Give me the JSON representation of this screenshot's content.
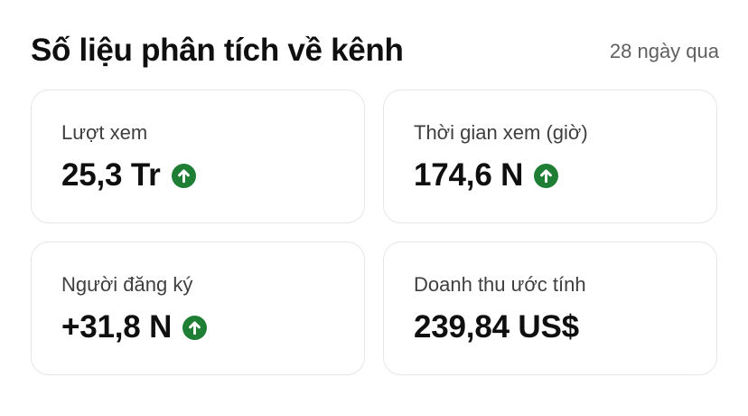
{
  "header": {
    "title": "Số liệu phân tích về kênh",
    "period": "28 ngày qua"
  },
  "cards": [
    {
      "label": "Lượt xem",
      "value": "25,3 Tr",
      "trend": "up"
    },
    {
      "label": "Thời gian xem (giờ)",
      "value": "174,6 N",
      "trend": "up"
    },
    {
      "label": "Người đăng ký",
      "value": "+31,8 N",
      "trend": "up"
    },
    {
      "label": "Doanh thu ước tính",
      "value": "239,84 US$",
      "trend": "none"
    }
  ],
  "icons": {
    "trend_up": "arrow-up-circle-icon"
  },
  "colors": {
    "trend_up": "#1e7e34",
    "primary_text": "#0f0f0f",
    "secondary_text": "#606060",
    "card_border": "#e6e6e6"
  }
}
